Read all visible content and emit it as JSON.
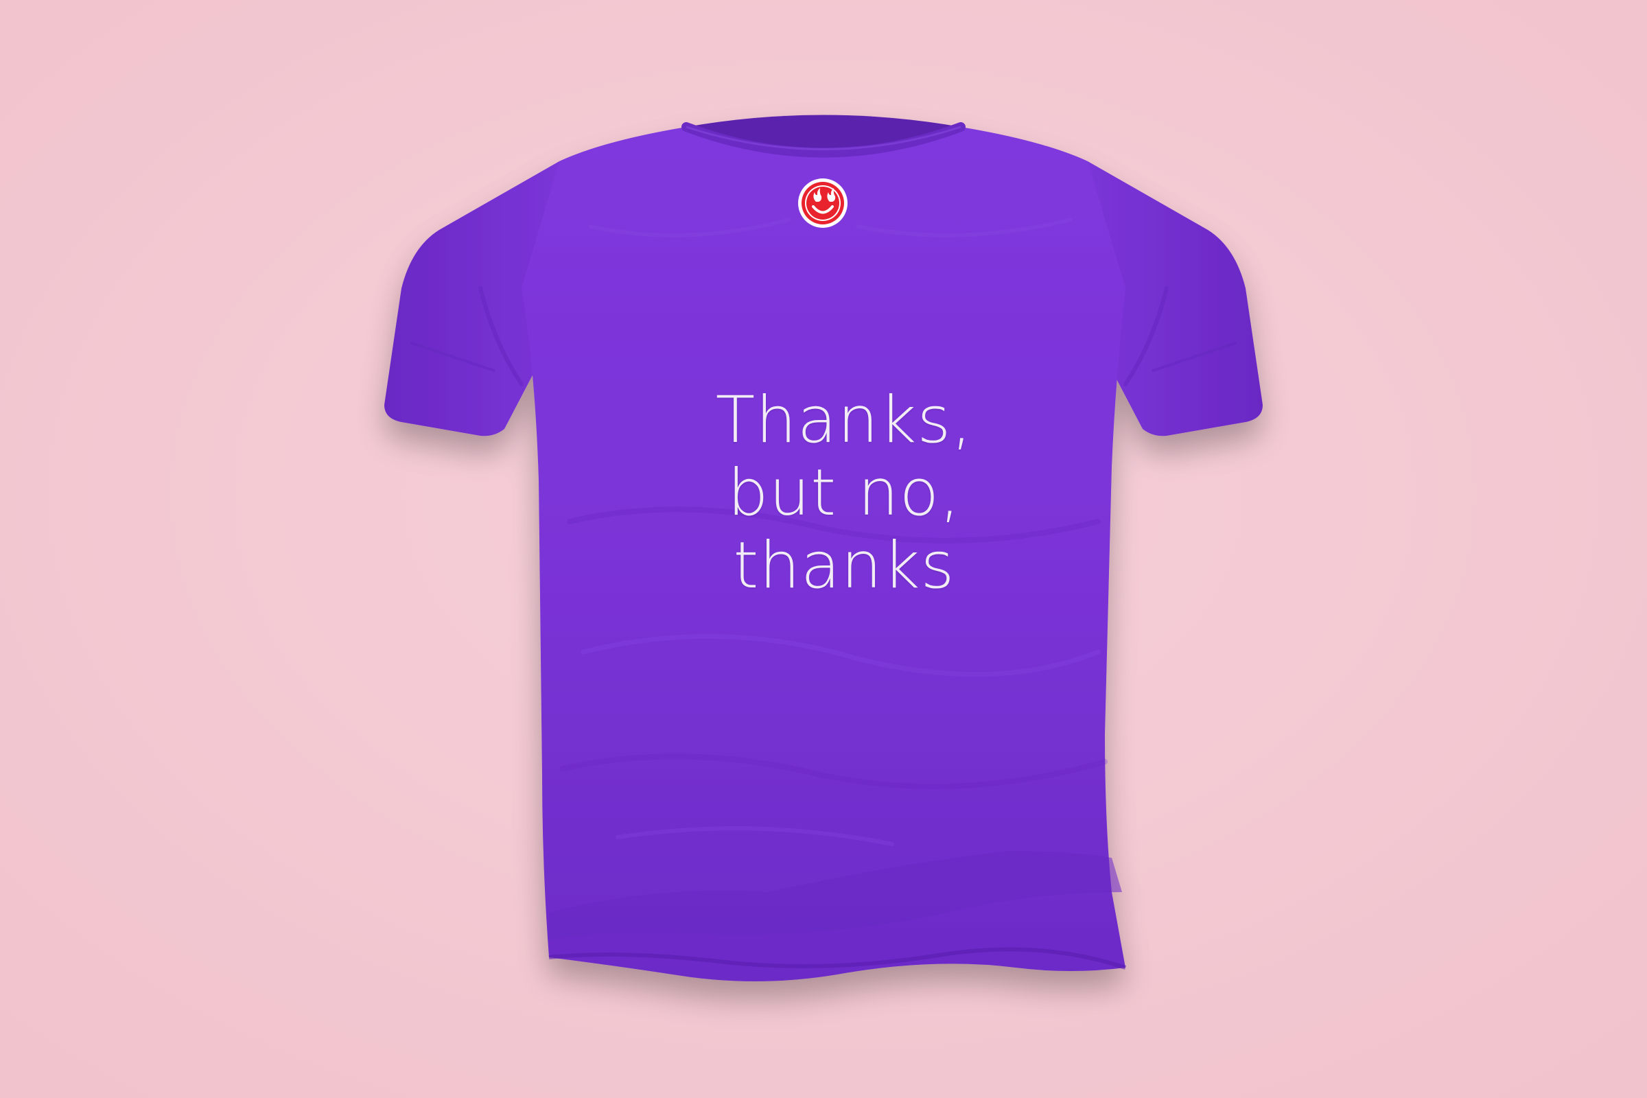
{
  "colors": {
    "background": "#f4cbd4",
    "shirt": "#7a34d8",
    "shirt_shadow": "#5f22b4",
    "print_text": "#f1ecf6",
    "logo_red": "#e8232e"
  },
  "icons": {
    "neck_label": "smiley-face-with-flame-eyes-icon"
  },
  "shirt": {
    "print_lines": [
      "Thanks,",
      "but no,",
      "thanks"
    ]
  }
}
